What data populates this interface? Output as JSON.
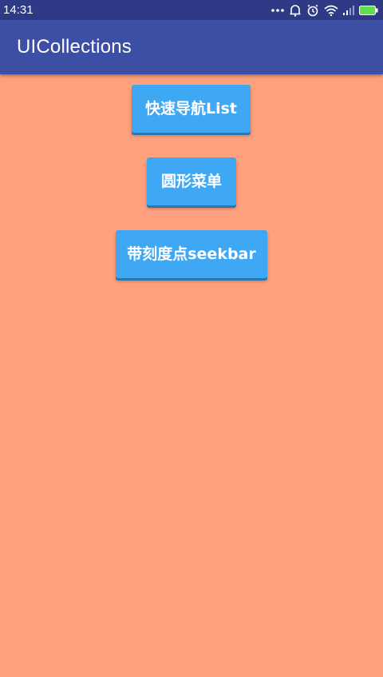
{
  "status_bar": {
    "time": "14:31",
    "icons": [
      "more-dots-icon",
      "alarm-icon",
      "headset-icon",
      "wifi-icon",
      "signal-icon",
      "battery-icon"
    ]
  },
  "app_bar": {
    "title": "UICollections"
  },
  "buttons": {
    "quick_nav_list": "快速导航List",
    "circle_menu": "圆形菜单",
    "tick_seekbar": "带刻度点seekbar"
  },
  "colors": {
    "status_bar": "#2e3a86",
    "app_bar": "#3d4fa4",
    "background": "#ffa17e",
    "button": "#3ea8f4",
    "battery": "#5fe04a"
  }
}
